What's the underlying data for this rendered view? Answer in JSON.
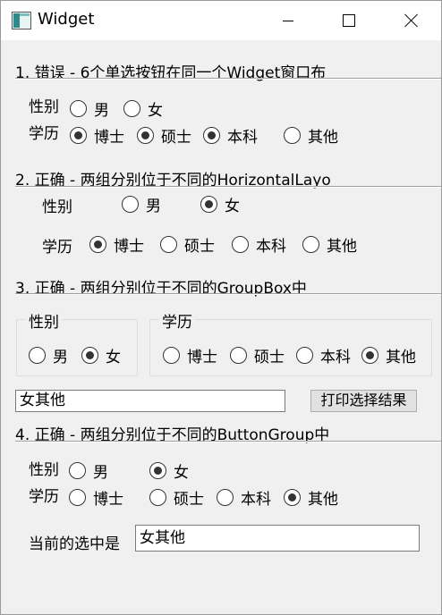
{
  "window": {
    "title": "Widget",
    "icon": "qt-app-icon"
  },
  "section1": {
    "title": "1. 错误 - 6个单选按钮在同一个Widget窗口布",
    "gender_label": "性别",
    "edu_label": "学历",
    "gender_options": [
      {
        "label": "男",
        "checked": false
      },
      {
        "label": "女",
        "checked": false
      }
    ],
    "edu_options": [
      {
        "label": "博士",
        "checked": true
      },
      {
        "label": "硕士",
        "checked": true
      },
      {
        "label": "本科",
        "checked": true
      },
      {
        "label": "其他",
        "checked": false
      }
    ]
  },
  "section2": {
    "title": "2. 正确 - 两组分别位于不同的HorizontalLayo",
    "gender_label": "性别",
    "edu_label": "学历",
    "gender_options": [
      {
        "label": "男",
        "checked": false
      },
      {
        "label": "女",
        "checked": true
      }
    ],
    "edu_options": [
      {
        "label": "博士",
        "checked": true
      },
      {
        "label": "硕士",
        "checked": false
      },
      {
        "label": "本科",
        "checked": false
      },
      {
        "label": "其他",
        "checked": false
      }
    ]
  },
  "section3": {
    "title": "3. 正确 - 两组分别位于不同的GroupBox中",
    "gender_group_title": "性别",
    "edu_group_title": "学历",
    "gender_options": [
      {
        "label": "男",
        "checked": false
      },
      {
        "label": "女",
        "checked": true
      }
    ],
    "edu_options": [
      {
        "label": "博士",
        "checked": false
      },
      {
        "label": "硕士",
        "checked": false
      },
      {
        "label": "本科",
        "checked": false
      },
      {
        "label": "其他",
        "checked": true
      }
    ],
    "result_value": "女其他",
    "print_button": "打印选择结果"
  },
  "section4": {
    "title": "4. 正确 - 两组分别位于不同的ButtonGroup中",
    "gender_label": "性别",
    "edu_label": "学历",
    "gender_options": [
      {
        "label": "男",
        "checked": false
      },
      {
        "label": "女",
        "checked": true
      }
    ],
    "edu_options": [
      {
        "label": "博士",
        "checked": false
      },
      {
        "label": "硕士",
        "checked": false
      },
      {
        "label": "本科",
        "checked": false
      },
      {
        "label": "其他",
        "checked": true
      }
    ],
    "current_label": "当前的选中是",
    "current_value": "女其他"
  }
}
